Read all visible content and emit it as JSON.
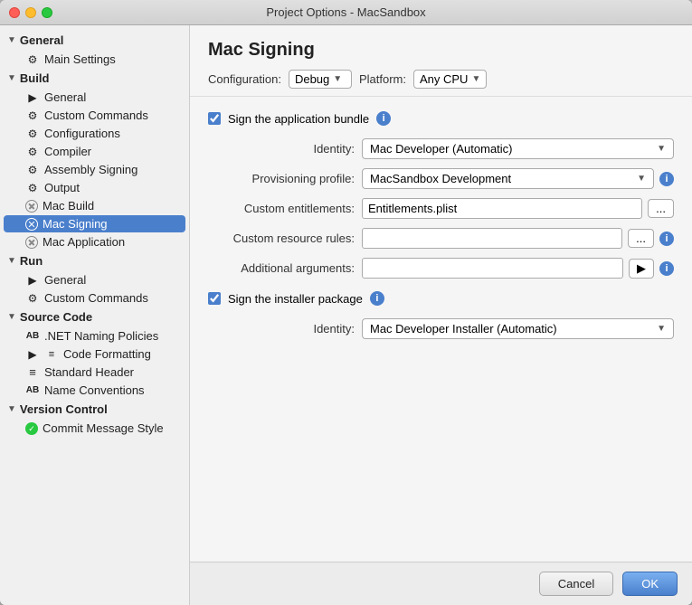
{
  "window": {
    "title": "Project Options - MacSandbox"
  },
  "sidebar": {
    "sections": [
      {
        "id": "general",
        "label": "General",
        "expanded": true,
        "items": [
          {
            "id": "main-settings",
            "label": "Main Settings",
            "icon": "gear",
            "level": 1
          }
        ]
      },
      {
        "id": "build",
        "label": "Build",
        "expanded": true,
        "items": [
          {
            "id": "general",
            "label": "General",
            "icon": "play",
            "level": 1
          },
          {
            "id": "custom-commands",
            "label": "Custom Commands",
            "icon": "gear",
            "level": 1
          },
          {
            "id": "configurations",
            "label": "Configurations",
            "icon": "gear",
            "level": 1
          },
          {
            "id": "compiler",
            "label": "Compiler",
            "icon": "gear",
            "level": 1
          },
          {
            "id": "assembly-signing",
            "label": "Assembly Signing",
            "icon": "gear",
            "level": 1
          },
          {
            "id": "output",
            "label": "Output",
            "icon": "gear",
            "level": 1
          },
          {
            "id": "mac-build",
            "label": "Mac Build",
            "icon": "x",
            "level": 1
          },
          {
            "id": "mac-signing",
            "label": "Mac Signing",
            "icon": "x-active",
            "level": 1,
            "active": true
          },
          {
            "id": "mac-application",
            "label": "Mac Application",
            "icon": "x",
            "level": 1
          }
        ]
      },
      {
        "id": "run",
        "label": "Run",
        "expanded": true,
        "items": [
          {
            "id": "run-general",
            "label": "General",
            "icon": "play",
            "level": 1
          },
          {
            "id": "run-custom",
            "label": "Custom Commands",
            "icon": "gear",
            "level": 1
          }
        ]
      },
      {
        "id": "source-code",
        "label": "Source Code",
        "expanded": true,
        "items": [
          {
            "id": "naming-policies",
            "label": ".NET Naming Policies",
            "icon": "ab",
            "level": 1
          },
          {
            "id": "code-formatting",
            "label": "Code Formatting",
            "icon": "expand",
            "level": 1
          },
          {
            "id": "standard-header",
            "label": "Standard Header",
            "icon": "lines",
            "level": 1
          },
          {
            "id": "name-conventions",
            "label": "Name Conventions",
            "icon": "ab",
            "level": 1
          }
        ]
      },
      {
        "id": "version-control",
        "label": "Version Control",
        "expanded": true,
        "items": [
          {
            "id": "commit-message",
            "label": "Commit Message Style",
            "icon": "check",
            "level": 1
          }
        ]
      }
    ]
  },
  "main": {
    "title": "Mac Signing",
    "config_label": "Configuration:",
    "config_value": "Debug",
    "platform_label": "Platform:",
    "platform_value": "Any CPU",
    "sign_bundle_label": "Sign the application bundle",
    "identity_label": "Identity:",
    "identity_value": "Mac Developer (Automatic)",
    "provisioning_label": "Provisioning profile:",
    "provisioning_value": "MacSandbox Development",
    "entitlements_label": "Custom entitlements:",
    "entitlements_value": "Entitlements.plist",
    "resource_rules_label": "Custom resource rules:",
    "resource_rules_value": "",
    "additional_args_label": "Additional arguments:",
    "additional_args_value": "",
    "sign_installer_label": "Sign the installer package",
    "installer_identity_label": "Identity:",
    "installer_identity_value": "Mac Developer Installer (Automatic)",
    "dots_btn": "...",
    "arrow_btn": "▶"
  },
  "footer": {
    "cancel_label": "Cancel",
    "ok_label": "OK"
  }
}
